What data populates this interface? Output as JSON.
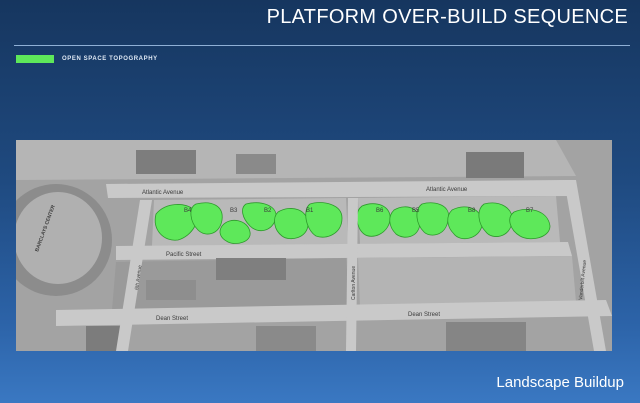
{
  "slide": {
    "title": "PLATFORM OVER-BUILD SEQUENCE",
    "caption": "Landscape Buildup"
  },
  "legend": {
    "label": "OPEN SPACE TOPOGRAPHY",
    "color": "#5ee85a"
  },
  "map": {
    "streets": {
      "atlantic_left": "Atlantic Avenue",
      "atlantic_right": "Atlantic Avenue",
      "pacific": "Pacific Street",
      "dean_left": "Dean Street",
      "dean_right": "Dean Street",
      "sixth": "6th Avenue",
      "carlton": "Carlton Avenue",
      "vanderbilt": "Vanderbilt Avenue"
    },
    "arena_sign": "BARCLAYS CENTER",
    "parcels": [
      "B4",
      "B3",
      "B2",
      "B1",
      "B6",
      "B5",
      "B8",
      "B7"
    ],
    "colors": {
      "green": "#5ee85a",
      "ground": "#a3a3a3",
      "street": "#c9c9c9",
      "building": "#8c8c8c"
    }
  }
}
